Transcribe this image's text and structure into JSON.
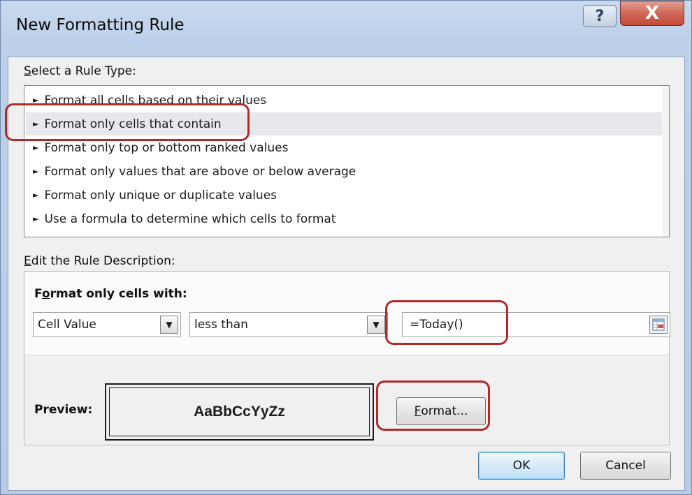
{
  "window": {
    "title": "New Formatting Rule",
    "help_label": "?",
    "close_label": "X"
  },
  "rule_type": {
    "label_accel": "S",
    "label_rest": "elect a Rule Type:",
    "items": [
      {
        "label": "Format all cells based on their values"
      },
      {
        "label": "Format only cells that contain"
      },
      {
        "label": "Format only top or bottom ranked values"
      },
      {
        "label": "Format only values that are above or below average"
      },
      {
        "label": "Format only unique or duplicate values"
      },
      {
        "label": "Use a formula to determine which cells to format"
      }
    ],
    "selected_index": 1
  },
  "description": {
    "label_accel": "E",
    "label_rest": "dit the Rule Description:",
    "heading_pre": "F",
    "heading_accel": "o",
    "heading_post": "rmat only cells with:",
    "condition_field": "Cell Value",
    "operator": "less than",
    "value": "=Today()",
    "preview_label": "Preview:",
    "preview_sample": "AaBbCcYyZz",
    "format_accel": "F",
    "format_rest": "ormat..."
  },
  "buttons": {
    "ok": "OK",
    "cancel": "Cancel"
  },
  "colors": {
    "highlight": "#b02a2a",
    "title_bar": "#bcd0ea",
    "close_button": "#c34a39"
  }
}
